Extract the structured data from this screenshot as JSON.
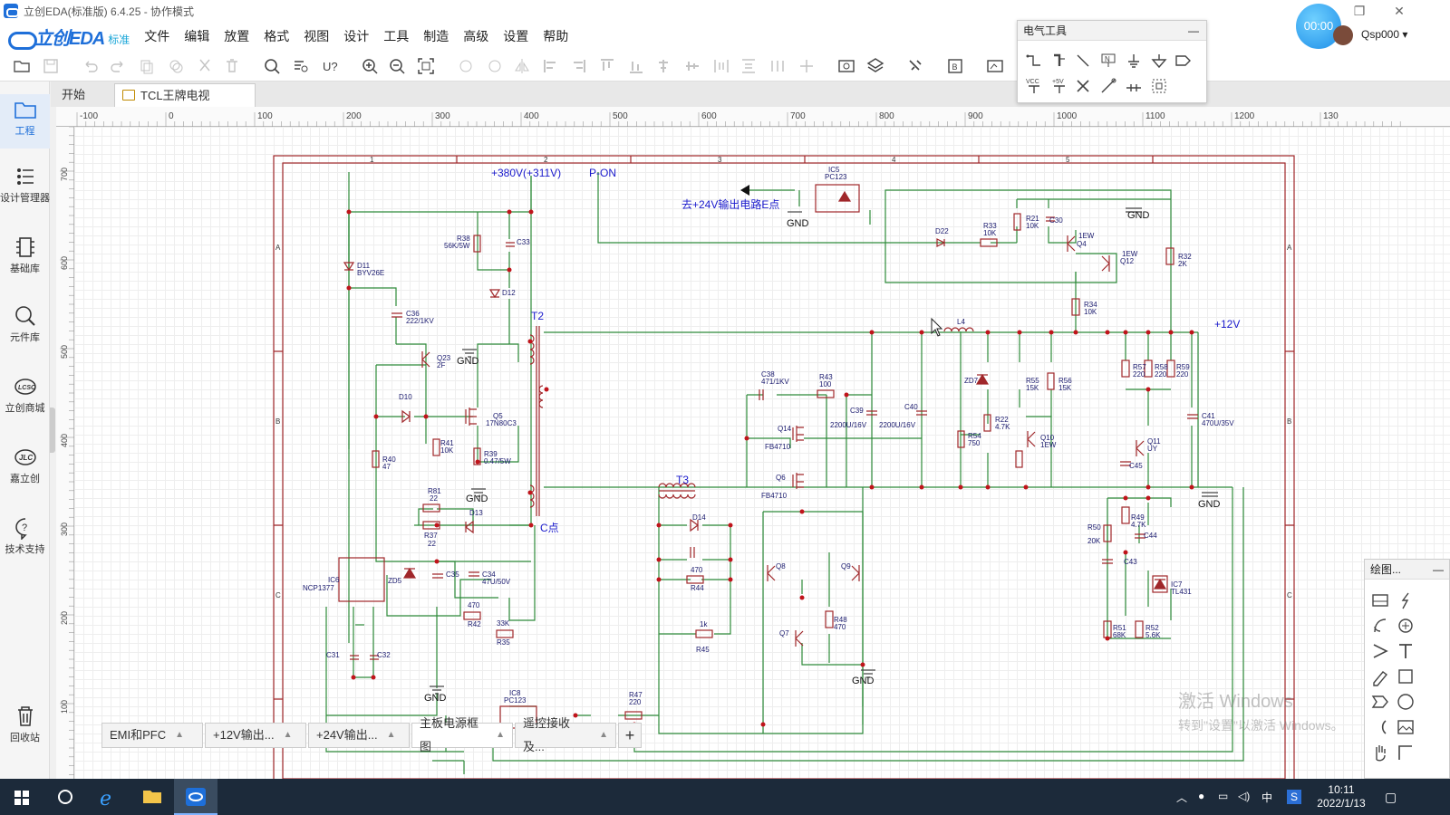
{
  "window": {
    "title": "立创EDA(标准版) 6.4.25 - 协作模式",
    "controls": [
      "restore-icon",
      "close-icon"
    ]
  },
  "menubar": {
    "brand": "立创EDA",
    "edition": "标准",
    "items": [
      "文件",
      "编辑",
      "放置",
      "格式",
      "视图",
      "设计",
      "工具",
      "制造",
      "高级",
      "设置",
      "帮助"
    ]
  },
  "timer": "00:00",
  "user": "Qsp000 ▾",
  "sidebar": {
    "items": [
      {
        "label": "工程",
        "icon": "folder-icon"
      },
      {
        "label": "设计管理器",
        "icon": "tree-icon"
      },
      {
        "label": "基础库",
        "icon": "chip-icon"
      },
      {
        "label": "元件库",
        "icon": "search-chip-icon"
      },
      {
        "label": "立创商城",
        "icon": "lcsc-icon"
      },
      {
        "label": "嘉立创",
        "icon": "jlc-icon"
      },
      {
        "label": "技术支持",
        "icon": "help-icon"
      },
      {
        "label": "回收站",
        "icon": "trash-icon"
      }
    ]
  },
  "doc_tabs": [
    {
      "label": "开始"
    },
    {
      "label": "TCL王牌电视"
    }
  ],
  "ruler": {
    "top_labels": [
      "-100",
      "0",
      "100",
      "200",
      "300",
      "400",
      "500",
      "600",
      "700",
      "800",
      "900",
      "1000",
      "1100",
      "1200",
      "130"
    ],
    "left_labels": [
      "700",
      "600",
      "500",
      "400",
      "300",
      "200",
      "100"
    ]
  },
  "elec_panel": {
    "title": "电气工具",
    "minimize": "—",
    "tools": [
      "wire-icon",
      "bus-icon",
      "bus-entry-icon",
      "net-label-icon",
      "net-flag-gnd-icon",
      "net-flag-gnd2-icon",
      "net-port-icon",
      "vcc-icon",
      "plus5v-icon",
      "no-connect-icon",
      "pin-icon",
      "voltage-probe-icon",
      "group-icon"
    ],
    "vcc_label": "VCC",
    "plus5_label": "+5V"
  },
  "draw_panel": {
    "title": "绘图...",
    "minimize": "—",
    "tools": [
      "image-icon",
      "pen-icon",
      "arc-icon",
      "circle-plus-icon",
      "arrow-icon",
      "text-icon",
      "freehand-icon",
      "rect-icon",
      "polygon-icon",
      "circle-icon",
      "bezier-icon",
      "picture-icon",
      "hand-icon",
      "polyline-icon"
    ]
  },
  "sheet_tabs": [
    {
      "label": "EMI和PFC"
    },
    {
      "label": "+12V输出..."
    },
    {
      "label": "+24V输出..."
    },
    {
      "label": "主板电源框图"
    },
    {
      "label": "遥控接收及..."
    },
    {
      "label": "+"
    }
  ],
  "schematic": {
    "frame_cols": [
      "1",
      "2",
      "3",
      "4",
      "5"
    ],
    "frame_rows": [
      "A",
      "B",
      "C"
    ],
    "nets": {
      "v380": "+380V(+311V)",
      "pon": "P-ON",
      "to24v": "去+24V输出电路E点",
      "v12": "+12V",
      "cpoint": "C点",
      "t2": "T2",
      "t3": "T3",
      "gnd": "GND"
    },
    "labels": {
      "ic5": "IC5",
      "pc123": "PC123",
      "ic8": "IC8",
      "pc123b": "PC123",
      "d22": "D22",
      "r33": "R33",
      "r33v": "10K",
      "r21": "R21",
      "r21v": "10K",
      "c30": "C30",
      "q4": "Q4",
      "q4v": "1EW",
      "q12": "Q12",
      "q12v": "1EW",
      "r32": "R32",
      "r32v": "2K",
      "r34": "R34",
      "r34v": "10K",
      "r38": "R38",
      "r38v": "56K/5W",
      "c33": "C33",
      "d11": "D11",
      "d11v": "BYV26E",
      "d12": "D12",
      "c36": "C36",
      "c36v": "222/1KV",
      "q23": "Q23",
      "q23v": "2F",
      "d10": "D10",
      "q5": "Q5",
      "q5v": "17N80C3",
      "r41": "R41",
      "r41v": "10K",
      "r39": "R39",
      "r39v": "0.47/5W",
      "r40": "R40",
      "r40v": "47",
      "r81": "R81",
      "r81v": "22",
      "r37": "R37",
      "r37v": "22",
      "d13": "D13",
      "ic6": "IC6",
      "ncp": "NCP1377",
      "zd5": "ZD5",
      "c35": "C35",
      "c34": "C34",
      "c34v": "47U/50V",
      "r42": "R42",
      "r42v": "470",
      "r35": "R35",
      "r35v": "33K",
      "c31": "C31",
      "c32": "C32",
      "c38": "C38",
      "c38v": "471/1KV",
      "r43": "R43",
      "r43v": "100",
      "q14": "Q14",
      "fb1": "FB4710",
      "q6": "Q6",
      "fb2": "FB4710",
      "c39": "C39",
      "c39v": "2200U/16V",
      "c40": "C40",
      "c40v": "2200U/16V",
      "l4": "L4",
      "zd7": "ZD7",
      "r55": "R55",
      "r55v": "15K",
      "r56": "R56",
      "r56v": "15K",
      "r22": "R22",
      "r22v": "4.7K",
      "r54": "R54",
      "r54v": "750",
      "q10": "Q10",
      "q10v": "1EW",
      "r57": "R57",
      "r57v": "220",
      "r58": "R58",
      "r58v": "220",
      "r59": "R59",
      "r59v": "220",
      "c41": "C41",
      "c41v": "470U/35V",
      "q11": "Q11",
      "q11v": "UY",
      "c45": "C45",
      "r49": "R49",
      "r49v": "4.7K",
      "r50": "R50",
      "r50v": "20K",
      "c44": "C44",
      "c43": "C43",
      "ic7": "IC7",
      "tl431": "TL431",
      "r51": "R51",
      "r51v": "68K",
      "r52": "R52",
      "r52v": "5.6K",
      "d14": "D14",
      "r44": "R44",
      "r44v": "470",
      "r45": "R45",
      "r45v": "1k",
      "q8": "Q8",
      "q9": "Q9",
      "q7": "Q7",
      "r48": "R48",
      "r48v": "470",
      "r47": "R47",
      "r47v": "220"
    }
  },
  "watermark": {
    "line1": "激活 Windows",
    "line2": "转到\"设置\"以激活 Windows。"
  },
  "taskbar": {
    "time": "10:11",
    "date": "2022/1/13",
    "ime": "中"
  },
  "colors": {
    "accent": "#1e6fd9",
    "wire": "#2e8b3a",
    "frame": "#a0272a",
    "net_label": "#1a1acc",
    "component": "#a0272a",
    "junction": "#c0141b",
    "taskbar": "#1c2a3a"
  }
}
